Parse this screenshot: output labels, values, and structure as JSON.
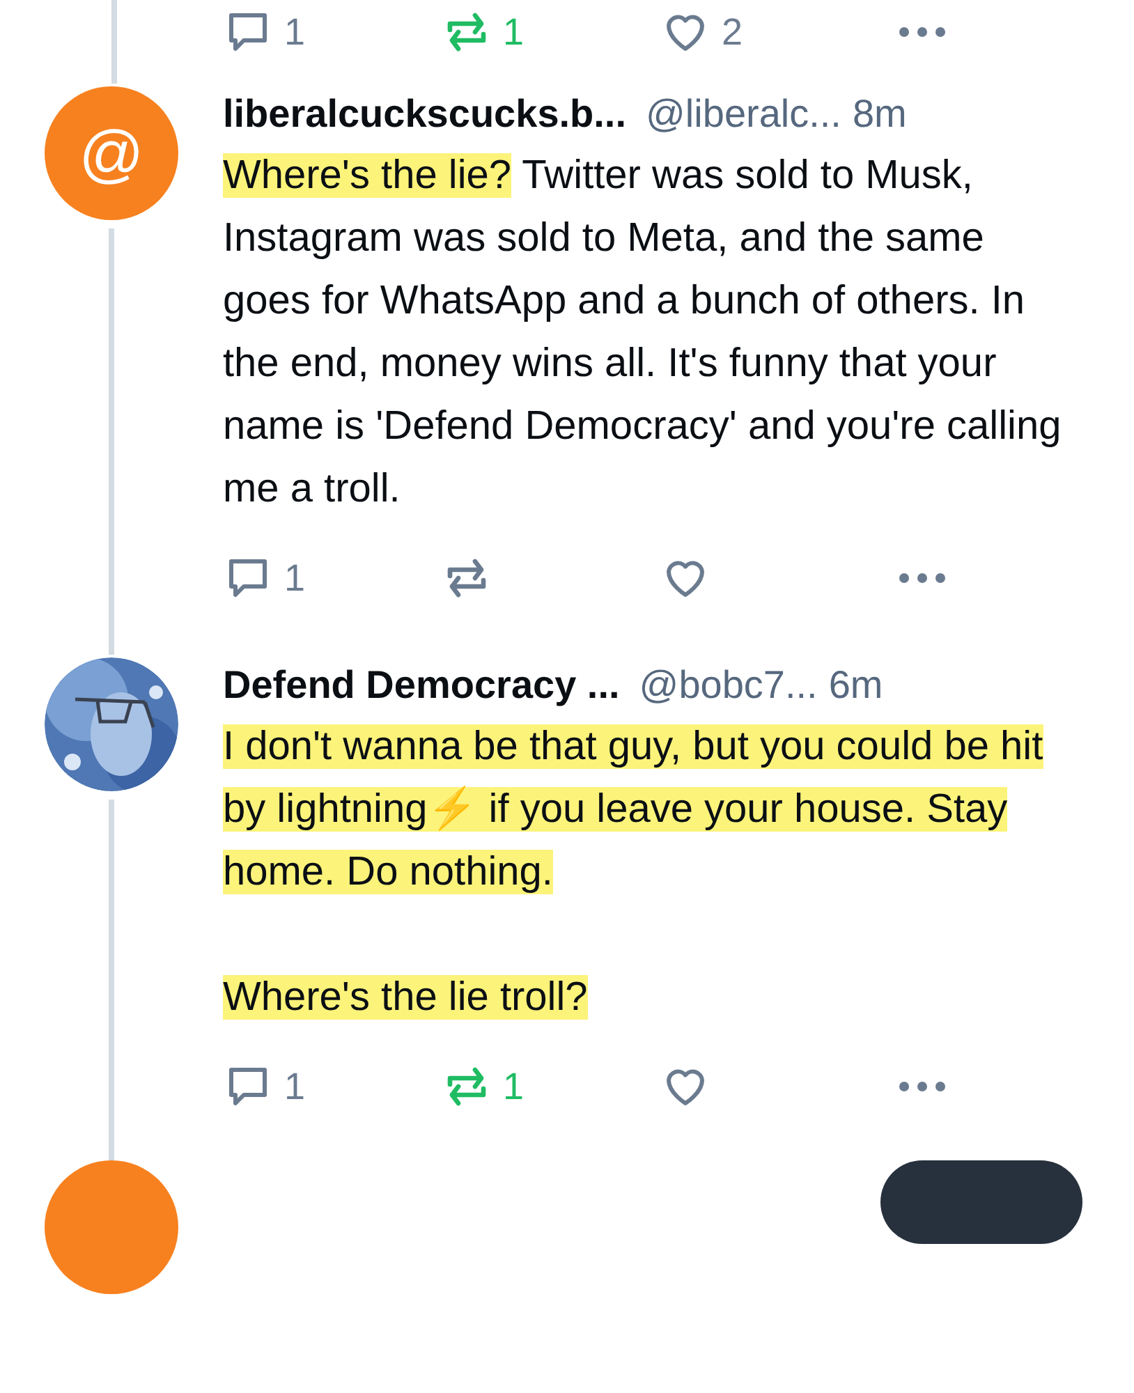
{
  "previous_post_actions": {
    "replies": "1",
    "reposts": "1",
    "reposted": true,
    "likes": "2",
    "liked": false
  },
  "posts": [
    {
      "avatar": {
        "kind": "glyph",
        "glyph": "@"
      },
      "display_name": "liberalcuckscucks.b...",
      "handle": "@liberalc...",
      "time": "8m",
      "body": [
        [
          {
            "text": "Where's the lie?",
            "highlighted": true
          },
          {
            "text": " Twitter was sold to Musk, Instagram was sold to Meta, and the same goes for WhatsApp and a bunch of others. In the end, money wins all. It's funny that your name is 'Defend Democracy' and you're calling me a troll.",
            "highlighted": false
          }
        ]
      ],
      "actions": {
        "replies": "1",
        "reposted": false,
        "liked": false
      }
    },
    {
      "avatar": {
        "kind": "picture"
      },
      "display_name": "Defend Democracy ...",
      "handle": "@bobc7...",
      "time": "6m",
      "body": [
        [
          {
            "text": "I don't wanna be that guy, but you could be hit by lightning⚡ if you leave your house. Stay home. Do nothing.",
            "highlighted": true
          }
        ],
        [
          {
            "text": "Where's the lie troll?",
            "highlighted": true
          }
        ]
      ],
      "actions": {
        "replies": "1",
        "reposts": "1",
        "reposted": true,
        "liked": false
      }
    }
  ]
}
